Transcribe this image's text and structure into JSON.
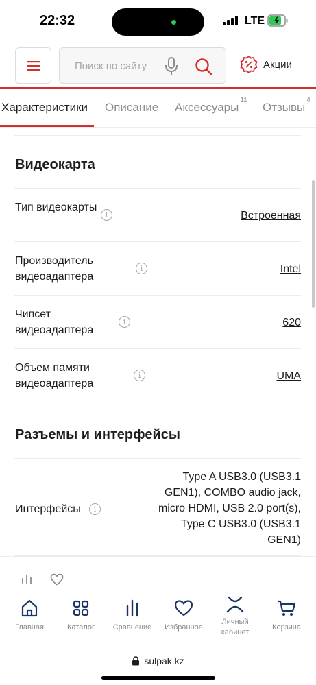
{
  "status_bar": {
    "time": "22:32",
    "network": "LTE"
  },
  "header": {
    "search_placeholder": "Поиск по сайту",
    "promo_label": "Акции",
    "accent_color": "#d32f2f"
  },
  "tabs": [
    {
      "label": "Характеристики",
      "badge": ""
    },
    {
      "label": "Описание",
      "badge": ""
    },
    {
      "label": "Аксессуары",
      "badge": "11"
    },
    {
      "label": "Отзывы",
      "badge": "4"
    }
  ],
  "sections": [
    {
      "title": "Видеокарта",
      "rows": [
        {
          "label": "Тип видеокарты",
          "value": "Встроенная"
        },
        {
          "label": "Производитель видеоадаптера",
          "value": "Intel"
        },
        {
          "label": "Чипсет видеоадаптера",
          "value": "620"
        },
        {
          "label": "Объем памяти видеоадаптера",
          "value": "UMA"
        }
      ]
    },
    {
      "title": "Разъемы и интерфейсы",
      "rows": [
        {
          "label": "Интерфейсы",
          "value": "Type A USB3.0 (USB3.1 GEN1), COMBO audio jack, micro HDMI, USB 2.0 port(s), Type C USB3.0 (USB3.1 GEN1)"
        }
      ]
    }
  ],
  "bottom_nav": [
    {
      "label": "Главная",
      "icon": "home-icon"
    },
    {
      "label": "Каталог",
      "icon": "catalog-icon"
    },
    {
      "label": "Сравнение",
      "icon": "compare-icon"
    },
    {
      "label": "Избранное",
      "icon": "heart-icon"
    },
    {
      "label": "Личный кабинет",
      "icon": "profile-icon"
    },
    {
      "label": "Корзина",
      "icon": "cart-icon"
    }
  ],
  "browser": {
    "url": "sulpak.kz"
  }
}
